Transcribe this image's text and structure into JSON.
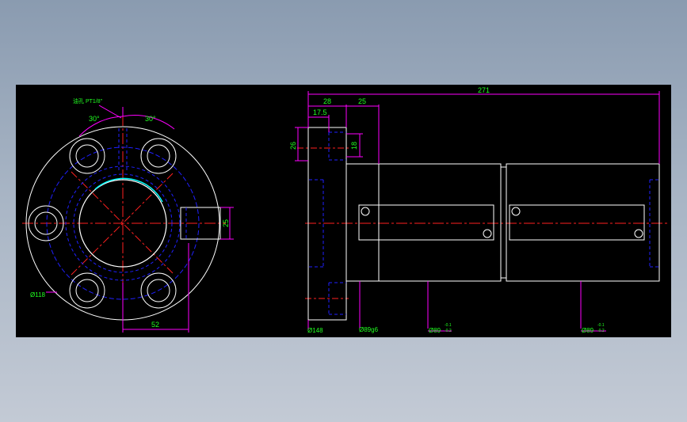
{
  "drawing": {
    "front_view": {
      "angle_left": "30°",
      "angle_right": "30°",
      "oil_hole_note": "油孔 PT1/8\"",
      "flange_width": "25",
      "bolt_offset": "52",
      "flange_diameter": "Ø118"
    },
    "side_view": {
      "overall_length": "271",
      "flange_length": "28",
      "body_step": "25",
      "oil_hole_pos": "17.5",
      "flange_height": "26",
      "slot_width": "18",
      "flange_od": "Ø148",
      "shaft_d1": "Ø89g6",
      "shaft_d2": "Ø89",
      "shaft_d2_upper": "-0.1",
      "shaft_d2_lower": "-0.2",
      "shaft_d3": "Ø89",
      "shaft_d3_upper": "-0.1",
      "shaft_d3_lower": "-0.2"
    }
  },
  "colors": {
    "background": "#000000",
    "outline": "#ffffff",
    "centerline": "#ff2020",
    "hidden": "#2020ff",
    "dimension": "#ff00ff",
    "dimension_text": "#20ff20",
    "highlight": "#00ffff"
  }
}
